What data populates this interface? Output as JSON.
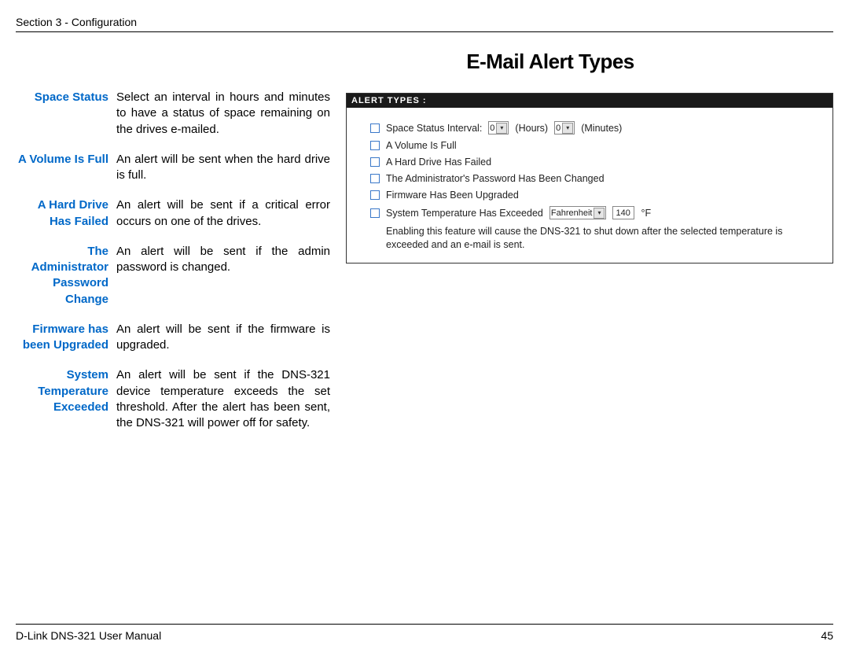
{
  "header": {
    "section": "Section 3 - Configuration"
  },
  "title": "E-Mail Alert Types",
  "definitions": [
    {
      "term": "Space Status",
      "desc": "Select an interval in hours and minutes to have a status of space remaining on the drives e-mailed."
    },
    {
      "term": "A Volume Is Full",
      "desc": "An alert will be sent when the hard drive is full."
    },
    {
      "term": "A Hard Drive Has Failed",
      "desc": "An alert will be sent if a critical error occurs on one of the drives."
    },
    {
      "term": "The Administrator Password Change",
      "desc": "An alert will be sent if the admin password is changed."
    },
    {
      "term": "Firmware has been Upgraded",
      "desc": "An alert will be sent if the firmware is upgraded."
    },
    {
      "term": "System Temperature Exceeded",
      "desc": "An alert will be sent if the DNS-321 device temperature exceeds the set threshold. After the alert has been sent, the DNS-321 will power off for safety."
    }
  ],
  "panel": {
    "header": "ALERT TYPES :",
    "rows": {
      "space_status_label": "Space Status   Interval:",
      "hours_value": "0",
      "hours_label": "(Hours)",
      "minutes_value": "0",
      "minutes_label": "(Minutes)",
      "volume_full": "A Volume Is Full",
      "hd_failed": "A Hard Drive Has Failed",
      "pw_changed": "The Administrator's Password Has Been Changed",
      "fw_upgraded": "Firmware Has Been Upgraded",
      "temp_exceeded": "System Temperature Has Exceeded",
      "temp_unit": "Fahrenheit",
      "temp_value": "140",
      "temp_suffix": "°F",
      "hint": "Enabling this feature will cause the DNS-321 to shut down after the selected temperature is exceeded and an e-mail is sent."
    }
  },
  "footer": {
    "manual": "D-Link DNS-321 User Manual",
    "page": "45"
  }
}
